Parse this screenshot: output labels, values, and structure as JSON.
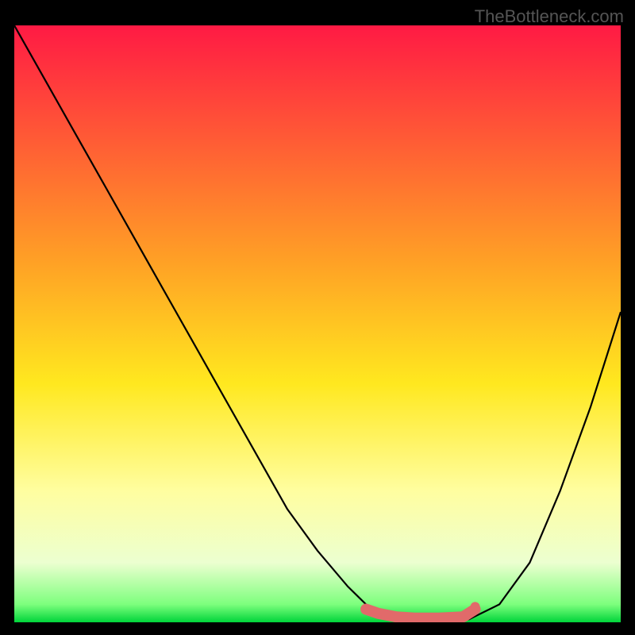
{
  "watermark": "TheBottleneck.com",
  "chart_data": {
    "type": "line",
    "title": "",
    "xlabel": "",
    "ylabel": "",
    "xlim": [
      0,
      100
    ],
    "ylim": [
      0,
      100
    ],
    "gradient_stops": [
      {
        "offset": 0,
        "color": "#ff1a44"
      },
      {
        "offset": 40,
        "color": "#ffa225"
      },
      {
        "offset": 60,
        "color": "#ffe81f"
      },
      {
        "offset": 78,
        "color": "#fffea0"
      },
      {
        "offset": 90,
        "color": "#ecffd0"
      },
      {
        "offset": 97,
        "color": "#7dff7d"
      },
      {
        "offset": 100,
        "color": "#00d43a"
      }
    ],
    "series": [
      {
        "name": "curve",
        "color": "#000000",
        "x": [
          0,
          5,
          10,
          15,
          20,
          25,
          30,
          35,
          40,
          45,
          50,
          55,
          58,
          60,
          63,
          66,
          70,
          75,
          80,
          85,
          90,
          95,
          100
        ],
        "y": [
          100,
          91,
          82,
          73,
          64,
          55,
          46,
          37,
          28,
          19,
          12,
          6,
          3,
          1.5,
          0.5,
          0.3,
          0.3,
          0.5,
          3,
          10,
          22,
          36,
          52
        ]
      }
    ],
    "highlight": {
      "color": "#e16a6a",
      "x": [
        58,
        60,
        63,
        66,
        70,
        74,
        76
      ],
      "y": [
        2.2,
        1.5,
        0.9,
        0.7,
        0.7,
        0.9,
        2.2
      ]
    },
    "highlight_dot": {
      "x": 76,
      "y": 2.6,
      "r": 6,
      "color": "#e16a6a"
    }
  }
}
